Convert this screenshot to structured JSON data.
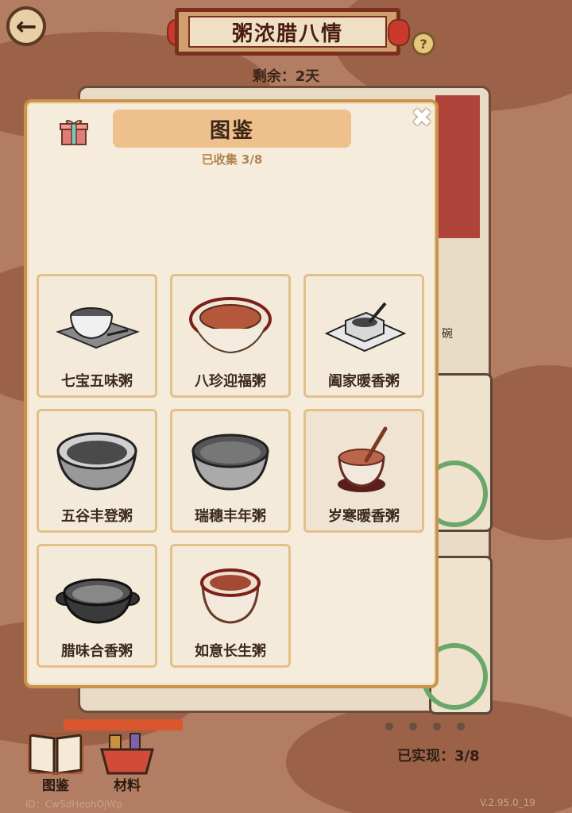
{
  "header": {
    "title": "粥浓腊八情",
    "remaining": "剩余：2天",
    "help_label": "?"
  },
  "modal": {
    "title": "图鉴",
    "collected": "已收集 3/8",
    "items": [
      {
        "name": "七宝五味粥",
        "collected": false,
        "icon": "porridge-cup-tray"
      },
      {
        "name": "八珍迎福粥",
        "collected": true,
        "icon": "porridge-bowl-red"
      },
      {
        "name": "阖家暖香粥",
        "collected": false,
        "icon": "porridge-box-spoon"
      },
      {
        "name": "五谷丰登粥",
        "collected": false,
        "icon": "porridge-bowl"
      },
      {
        "name": "瑞穗丰年粥",
        "collected": false,
        "icon": "porridge-bowl-deep"
      },
      {
        "name": "岁寒暖香粥",
        "collected": true,
        "icon": "porridge-cup-spoon"
      },
      {
        "name": "腊味合香粥",
        "collected": false,
        "icon": "porridge-pan"
      },
      {
        "name": "如意长生粥",
        "collected": true,
        "icon": "porridge-cup-red"
      }
    ]
  },
  "bottom": {
    "achieved": "已实现：3/8",
    "tab_catalog": "图鉴",
    "tab_materials": "材料",
    "user_id": "ID：CwSdHeohOjWp",
    "version": "V.2.95.0_19"
  },
  "background": {
    "bowl_label": "碗"
  }
}
